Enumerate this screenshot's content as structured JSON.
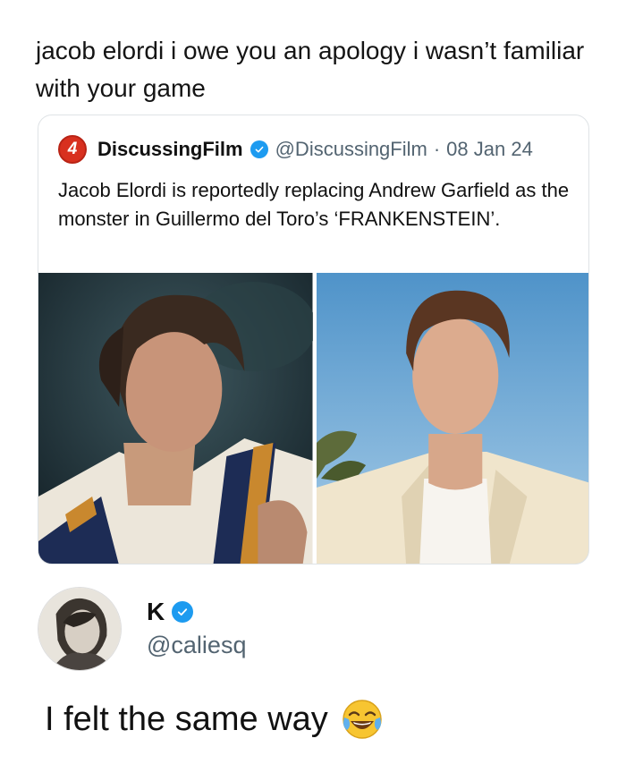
{
  "post": {
    "text": "jacob elordi i owe you an apology i wasn’t familiar with your game"
  },
  "quoted_tweet": {
    "logo_glyph": "4",
    "display_name": "DiscussingFilm",
    "handle": "@DiscussingFilm",
    "separator": "·",
    "date": "08 Jan 24",
    "text": "Jacob Elordi is reportedly replacing Andrew Garfield as the monster in Guillermo del Toro’s ‘FRANKENSTEIN’.",
    "logo_color": "#d8301f"
  },
  "reply": {
    "display_name": "K",
    "handle": "@caliesq",
    "text": "I felt the same way",
    "emoji_icon": "face-with-tears-of-joy-icon"
  },
  "colors": {
    "verified": "#1d9bf0",
    "secondary_text": "#536471"
  }
}
